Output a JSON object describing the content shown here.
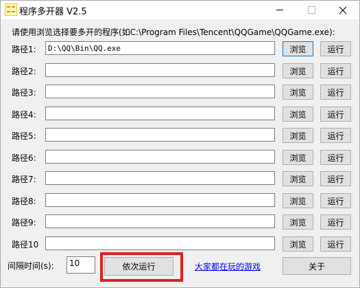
{
  "window": {
    "title": "程序多开器 V2.5",
    "icon": "app-icon",
    "controls": {
      "minimize": "minimize-icon",
      "maximize": "maximize-icon",
      "close": "close-icon"
    }
  },
  "instruction": "请使用浏览选择要多开的程序(如C:\\Program Files\\Tencent\\QQGame\\QQGame.exe):",
  "paths": [
    {
      "label": "路径1:",
      "value": "D:\\QQ\\Bin\\QQ.exe",
      "browse": "浏览",
      "run": "运行"
    },
    {
      "label": "路径2:",
      "value": "",
      "browse": "浏览",
      "run": "运行"
    },
    {
      "label": "路径3:",
      "value": "",
      "browse": "浏览",
      "run": "运行"
    },
    {
      "label": "路径4:",
      "value": "",
      "browse": "浏览",
      "run": "运行"
    },
    {
      "label": "路径5:",
      "value": "",
      "browse": "浏览",
      "run": "运行"
    },
    {
      "label": "路径6:",
      "value": "",
      "browse": "浏览",
      "run": "运行"
    },
    {
      "label": "路径7:",
      "value": "",
      "browse": "浏览",
      "run": "运行"
    },
    {
      "label": "路径8:",
      "value": "",
      "browse": "浏览",
      "run": "运行"
    },
    {
      "label": "路径9:",
      "value": "",
      "browse": "浏览",
      "run": "运行"
    },
    {
      "label": "路径10",
      "value": "",
      "browse": "浏览",
      "run": "运行"
    }
  ],
  "footer": {
    "interval_label": "间隔时间(s):",
    "interval_value": "10",
    "sequential_run": "依次运行",
    "games_link": "大家都在玩的游戏",
    "about": "关于"
  },
  "colors": {
    "highlight": "#e02020",
    "link": "#0000ee",
    "focus_border": "#0078d7"
  }
}
